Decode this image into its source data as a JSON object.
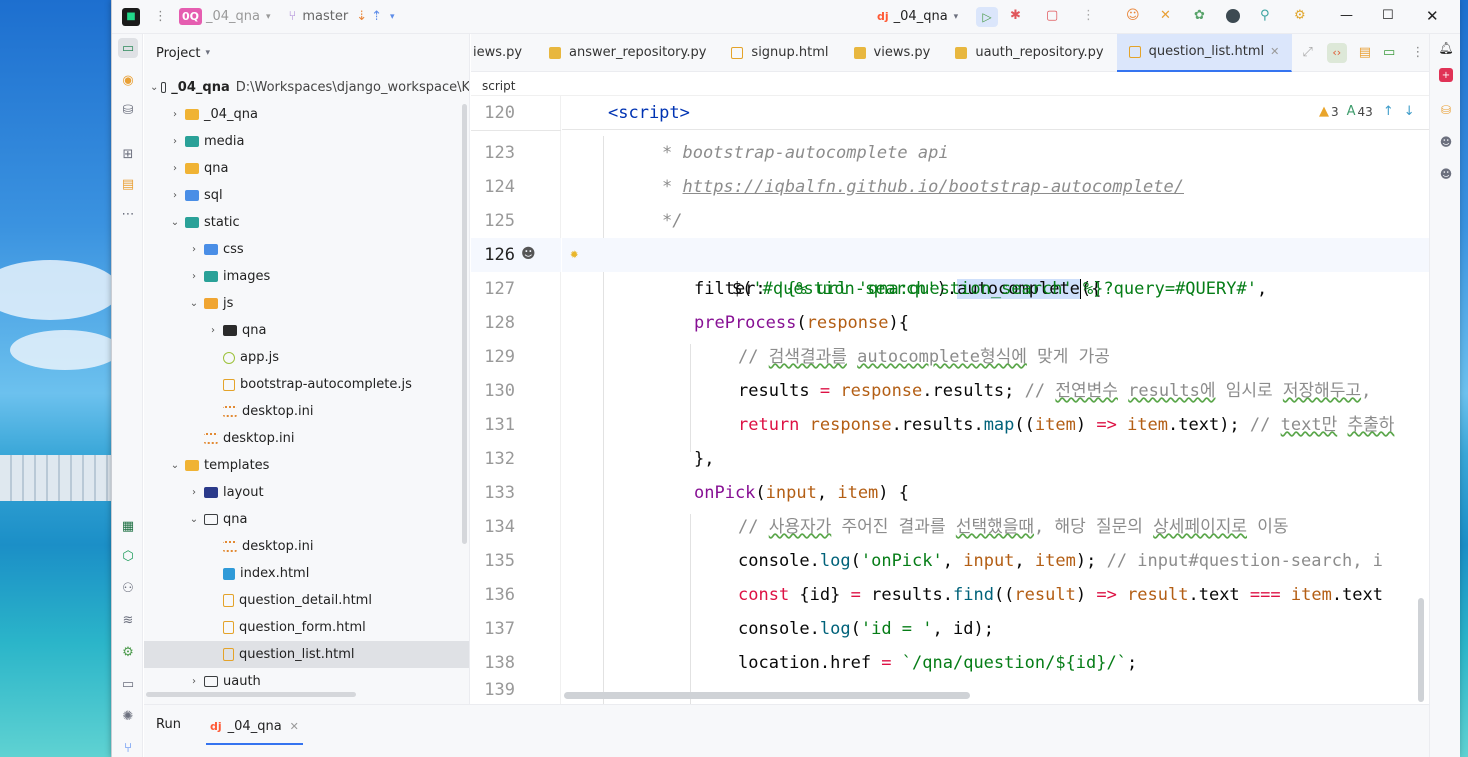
{
  "titlebar": {
    "project_badge": "0Q",
    "project_name": "_04_qna",
    "branch": "master",
    "run_config": "_04_qna"
  },
  "project_panel": {
    "title": "Project",
    "root_name": "_04_qna",
    "root_path": "D:\\Workspaces\\django_workspace\\K",
    "items": [
      {
        "label": "_04_qna"
      },
      {
        "label": "media"
      },
      {
        "label": "qna"
      },
      {
        "label": "sql"
      },
      {
        "label": "static"
      },
      {
        "label": "css"
      },
      {
        "label": "images"
      },
      {
        "label": "js"
      },
      {
        "label": "qna"
      },
      {
        "label": "app.js"
      },
      {
        "label": "bootstrap-autocomplete.js"
      },
      {
        "label": "desktop.ini"
      },
      {
        "label": "desktop.ini"
      },
      {
        "label": "templates"
      },
      {
        "label": "layout"
      },
      {
        "label": "qna"
      },
      {
        "label": "desktop.ini"
      },
      {
        "label": "index.html"
      },
      {
        "label": "question_detail.html"
      },
      {
        "label": "question_form.html"
      },
      {
        "label": "question_list.html"
      },
      {
        "label": "uauth"
      }
    ]
  },
  "tabs": [
    {
      "label": "iews.py"
    },
    {
      "label": "answer_repository.py"
    },
    {
      "label": "signup.html"
    },
    {
      "label": "views.py"
    },
    {
      "label": "uauth_repository.py"
    },
    {
      "label": "question_list.html"
    }
  ],
  "breadcrumb": "script",
  "inspections": {
    "warnings": "3",
    "typos": "43"
  },
  "code": {
    "sticky_line": {
      "num": "120",
      "text": "<script>"
    },
    "lines": [
      {
        "num": "123"
      },
      {
        "num": "124"
      },
      {
        "num": "125"
      },
      {
        "num": "126"
      },
      {
        "num": "127"
      },
      {
        "num": "128"
      },
      {
        "num": "129"
      },
      {
        "num": "130"
      },
      {
        "num": "131"
      },
      {
        "num": "132"
      },
      {
        "num": "133"
      },
      {
        "num": "134"
      },
      {
        "num": "135"
      },
      {
        "num": "136"
      },
      {
        "num": "137"
      },
      {
        "num": "138"
      },
      {
        "num": "139"
      }
    ],
    "l123": "* bootstrap-autocomplete api",
    "l124_star": "* ",
    "l124_url": "https://iqbalfn.github.io/bootstrap-autocomplete/",
    "l125": "*/",
    "l126_a": "$(",
    "l126_str": "'#question-search'",
    "l126_b": ").",
    "l126_fn": "autocomplete",
    "l126_c": "({",
    "l127_key": "filter",
    "l127_colon": ": ",
    "l127_str": "'{% url 'qna:question_search' %}?query=#QUERY#'",
    "l127_end": ",",
    "l128_fn": "preProcess",
    "l128_open": "(",
    "l128_par": "response",
    "l128_close": "){",
    "l129_a": "// ",
    "l129_w1": "검색결과를",
    "l129_b": " ",
    "l129_w2": "autocomplete형식에",
    "l129_c": " 맞게 가공",
    "l130_a": "results ",
    "l130_eq": "=",
    "l130_b": " ",
    "l130_par": "response",
    "l130_c": ".results; ",
    "l130_cm1": "// ",
    "l130_w1": "전연변수",
    "l130_cm2": " ",
    "l130_w2": "results에",
    "l130_cm3": " 임시로 ",
    "l130_w3": "저장해두고",
    "l130_cm4": ",",
    "l131_kw": "return",
    "l131_a": " ",
    "l131_par": "response",
    "l131_b": ".results.",
    "l131_fn": "map",
    "l131_c": "((",
    "l131_p2": "item",
    "l131_d": ") ",
    "l131_arrow": "=>",
    "l131_e": " ",
    "l131_p3": "item",
    "l131_f": ".text); ",
    "l131_cm1": "// ",
    "l131_w1": "text만",
    "l131_cm2": " ",
    "l131_w2": "추출하",
    "l132": "},",
    "l133_fn": "onPick",
    "l133_a": "(",
    "l133_p1": "input",
    "l133_b": ", ",
    "l133_p2": "item",
    "l133_c": ") {",
    "l134_a": "// ",
    "l134_w1": "사용자가",
    "l134_b": " 주어진 결과를 ",
    "l134_w2": "선택했을때",
    "l134_c": ", 해당 질문의 ",
    "l134_w3": "상세페이지로",
    "l134_d": " 이동",
    "l135_a": "console.",
    "l135_fn": "log",
    "l135_b": "(",
    "l135_str": "'onPick'",
    "l135_c": ", ",
    "l135_p1": "input",
    "l135_d": ", ",
    "l135_p2": "item",
    "l135_e": "); ",
    "l135_cm": "// input#question-search, i",
    "l136_kw": "const",
    "l136_a": " {id} ",
    "l136_eq": "=",
    "l136_b": " results.",
    "l136_fn": "find",
    "l136_c": "((",
    "l136_p1": "result",
    "l136_d": ") ",
    "l136_arrow": "=>",
    "l136_e": " ",
    "l136_p2": "result",
    "l136_f": ".text ",
    "l136_eq3": "===",
    "l136_g": " ",
    "l136_p3": "item",
    "l136_h": ".text",
    "l137_a": "console.",
    "l137_fn": "log",
    "l137_b": "(",
    "l137_str": "'id = '",
    "l137_c": ", id);",
    "l138_a": "location.href ",
    "l138_eq": "=",
    "l138_b": " ",
    "l138_str": "`/qna/question/${id}/`",
    "l138_c": ";"
  },
  "run_panel": {
    "title": "Run",
    "tab": "_04_qna"
  }
}
